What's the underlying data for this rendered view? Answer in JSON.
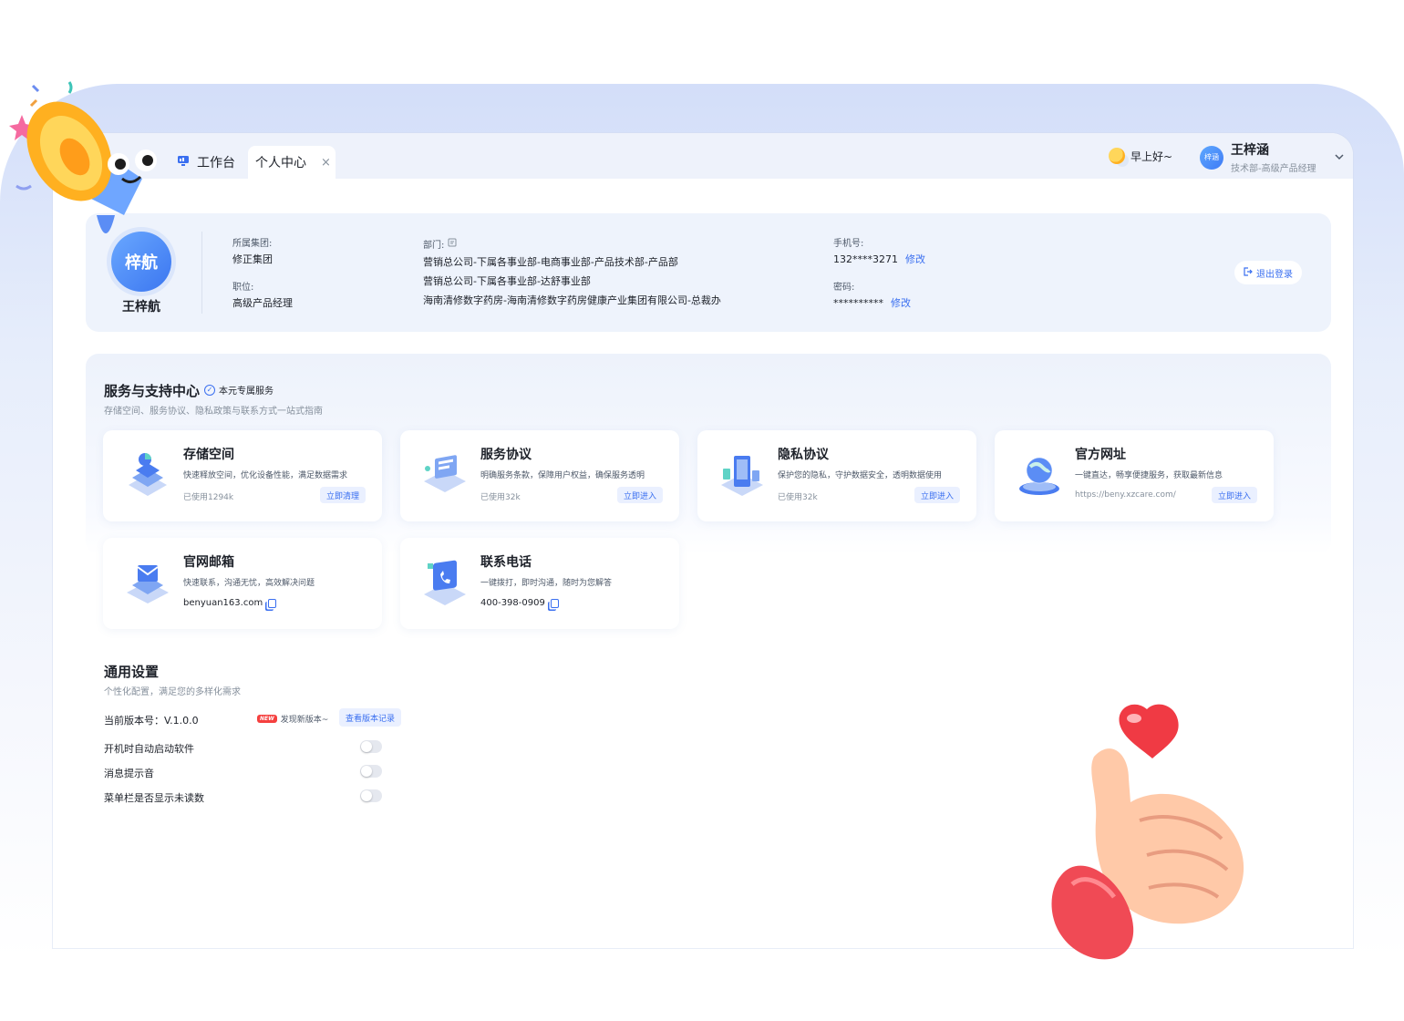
{
  "tabs": {
    "workbench": "工作台",
    "personal": "个人中心",
    "close": "×"
  },
  "header": {
    "greeting": "早上好~",
    "user_avatar_text": "梓涵",
    "user_name": "王梓涵",
    "user_dept": "技术部-高级产品经理"
  },
  "profile": {
    "avatar_text": "梓航",
    "name": "王梓航",
    "group_label": "所属集团:",
    "group_value": "修正集团",
    "position_label": "职位:",
    "position_value": "高级产品经理",
    "dept_label": "部门:",
    "departments": [
      "营销总公司-下属各事业部-电商事业部-产品技术部-产品部",
      "营销总公司-下属各事业部-达舒事业部",
      "海南清修数字药房-海南清修数字药房健康产业集团有限公司-总裁办"
    ],
    "phone_label": "手机号:",
    "phone_value": "132****3271",
    "password_label": "密码:",
    "password_value": "**********",
    "edit_label": "修改",
    "logout_label": "退出登录"
  },
  "service": {
    "title": "服务与支持中心",
    "badge": "本元专属服务",
    "subtitle": "存储空间、服务协议、隐私政策与联系方式一站式指南",
    "cards": [
      {
        "title": "存储空间",
        "desc": "快速释放空间，优化设备性能，满足数据需求",
        "meta": "已使用1294k",
        "button": "立即清理"
      },
      {
        "title": "服务协议",
        "desc": "明确服务条款，保障用户权益，确保服务透明",
        "meta": "已使用32k",
        "button": "立即进入"
      },
      {
        "title": "隐私协议",
        "desc": "保护您的隐私，守护数据安全，透明数据使用",
        "meta": "已使用32k",
        "button": "立即进入"
      },
      {
        "title": "官方网址",
        "desc": "一键直达，畅享便捷服务，获取最新信息",
        "meta": "https://beny.xzcare.com/",
        "button": "立即进入"
      },
      {
        "title": "官网邮箱",
        "desc": "快速联系，沟通无忧，高效解决问题",
        "meta": "benyuan163.com"
      },
      {
        "title": "联系电话",
        "desc": "一键拨打，即时沟通，随时为您解答",
        "meta": "400-398-0909"
      }
    ]
  },
  "settings": {
    "title": "通用设置",
    "subtitle": "个性化配置，满足您的多样化需求",
    "version_label": "当前版本号：V.1.0.0",
    "new_badge": "NEW",
    "new_text": "发现新版本~",
    "version_button": "查看版本记录",
    "toggles": [
      {
        "label": "开机时自动启动软件",
        "on": false
      },
      {
        "label": "消息提示音",
        "on": false
      },
      {
        "label": "菜单栏是否显示未读数",
        "on": false
      }
    ]
  },
  "colors": {
    "accent": "#3a6ff0",
    "backdrop": "#d3def9",
    "profile_bg": "#eef3fc"
  }
}
